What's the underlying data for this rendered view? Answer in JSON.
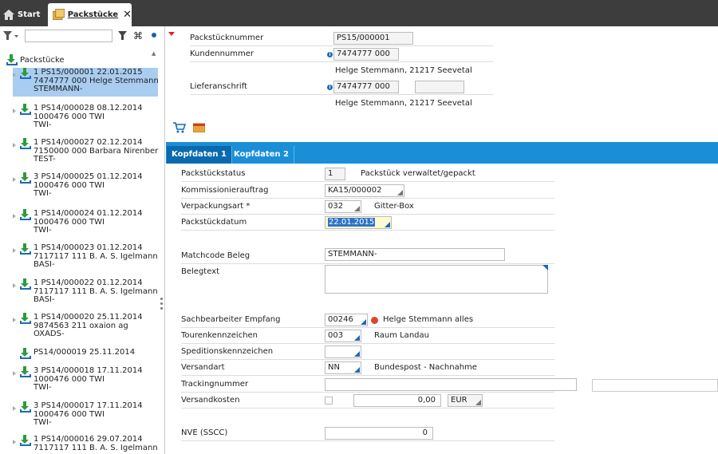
{
  "tabs": {
    "start": "Start",
    "current": "Packstücke",
    "close": "✕"
  },
  "sidebar": {
    "search_value": "",
    "root_label": "Packstücke",
    "items": [
      {
        "lines": "1 PS15/000001 22.01.2015\n7474777 000 Helge Stemmann\nSTEMMANN-",
        "selected": true
      },
      {
        "lines": "1 PS14/000028 08.12.2014\n1000476 000 TWI\nTWI-"
      },
      {
        "lines": "1 PS14/000027 02.12.2014\n7150000 000 Barbara Nirenber\nTEST-"
      },
      {
        "lines": "3 PS14/000025 01.12.2014\n1000476 000 TWI\nTWI-"
      },
      {
        "lines": "1 PS14/000024 01.12.2014\n1000476 000 TWI\nTWI-"
      },
      {
        "lines": "1 PS14/000023 01.12.2014\n7117117 111 B. A. S. Igelmann\nBASI-"
      },
      {
        "lines": "1 PS14/000022 01.12.2014\n7117117 111 B. A. S. Igelmann\nBASI-"
      },
      {
        "lines": "1 PS14/000020 25.11.2014\n9874563 211 oxaion ag\nOXADS-"
      },
      {
        "lines": "PS14/000019 25.11.2014"
      },
      {
        "lines": "3 PS14/000018 17.11.2014\n1000476 000 TWI\nTWI-"
      },
      {
        "lines": "3 PS14/000017 17.11.2014\n1000476 000 TWI\nTWI-"
      },
      {
        "lines": "1 PS14/000016 29.07.2014\n7117117 111 B. A. S. Igelmann"
      }
    ]
  },
  "header": {
    "packstueck_label": "Packstücknummer",
    "packstueck_value": "PS15/000001",
    "kunden_label": "Kundennummer",
    "kunden_value": "7474777 000",
    "kunden_name": "Helge Stemmann, 21217 Seevetal",
    "liefer_label": "Lieferanschrift",
    "liefer_value": "7474777 000",
    "liefer_extra": "",
    "liefer_name": "Helge Stemmann, 21217 Seevetal",
    "info_glyph": "i"
  },
  "subtabs": {
    "tab1": "Kopfdaten 1",
    "tab2": "Kopfdaten 2"
  },
  "form": {
    "status_label": "Packstückstatus",
    "status_value": "1",
    "status_text": "Packstück verwaltet/gepackt",
    "kommission_label": "Kommissionierauftrag",
    "kommission_value": "KA15/000002",
    "verpackung_label": "Verpackungsart *",
    "verpackung_value": "032",
    "verpackung_text": "Gitter-Box",
    "datum_label": "Packstückdatum",
    "datum_value": "22.01.2015",
    "matchcode_label": "Matchcode Beleg",
    "matchcode_value": "STEMMANN-",
    "belegtext_label": "Belegtext",
    "belegtext_value": "",
    "sachbearbeiter_label": "Sachbearbeiter Empfang",
    "sachbearbeiter_value": "00246",
    "sachbearbeiter_text": "Helge Stemmann alles",
    "touren_label": "Tourenkennzeichen",
    "touren_value": "003",
    "touren_text": "Raum Landau",
    "spedition_label": "Speditionskennzeichen",
    "spedition_value": "",
    "versandart_label": "Versandart",
    "versandart_value": "NN",
    "versandart_text": "Bundespost - Nachnahme",
    "tracking_label": "Trackingnummer",
    "tracking_value": "",
    "versandkosten_label": "Versandkosten",
    "versandkosten_value": "0,00",
    "waehrung_value": "EUR",
    "nve_label": "NVE (SSCC)",
    "nve_value": "0"
  }
}
